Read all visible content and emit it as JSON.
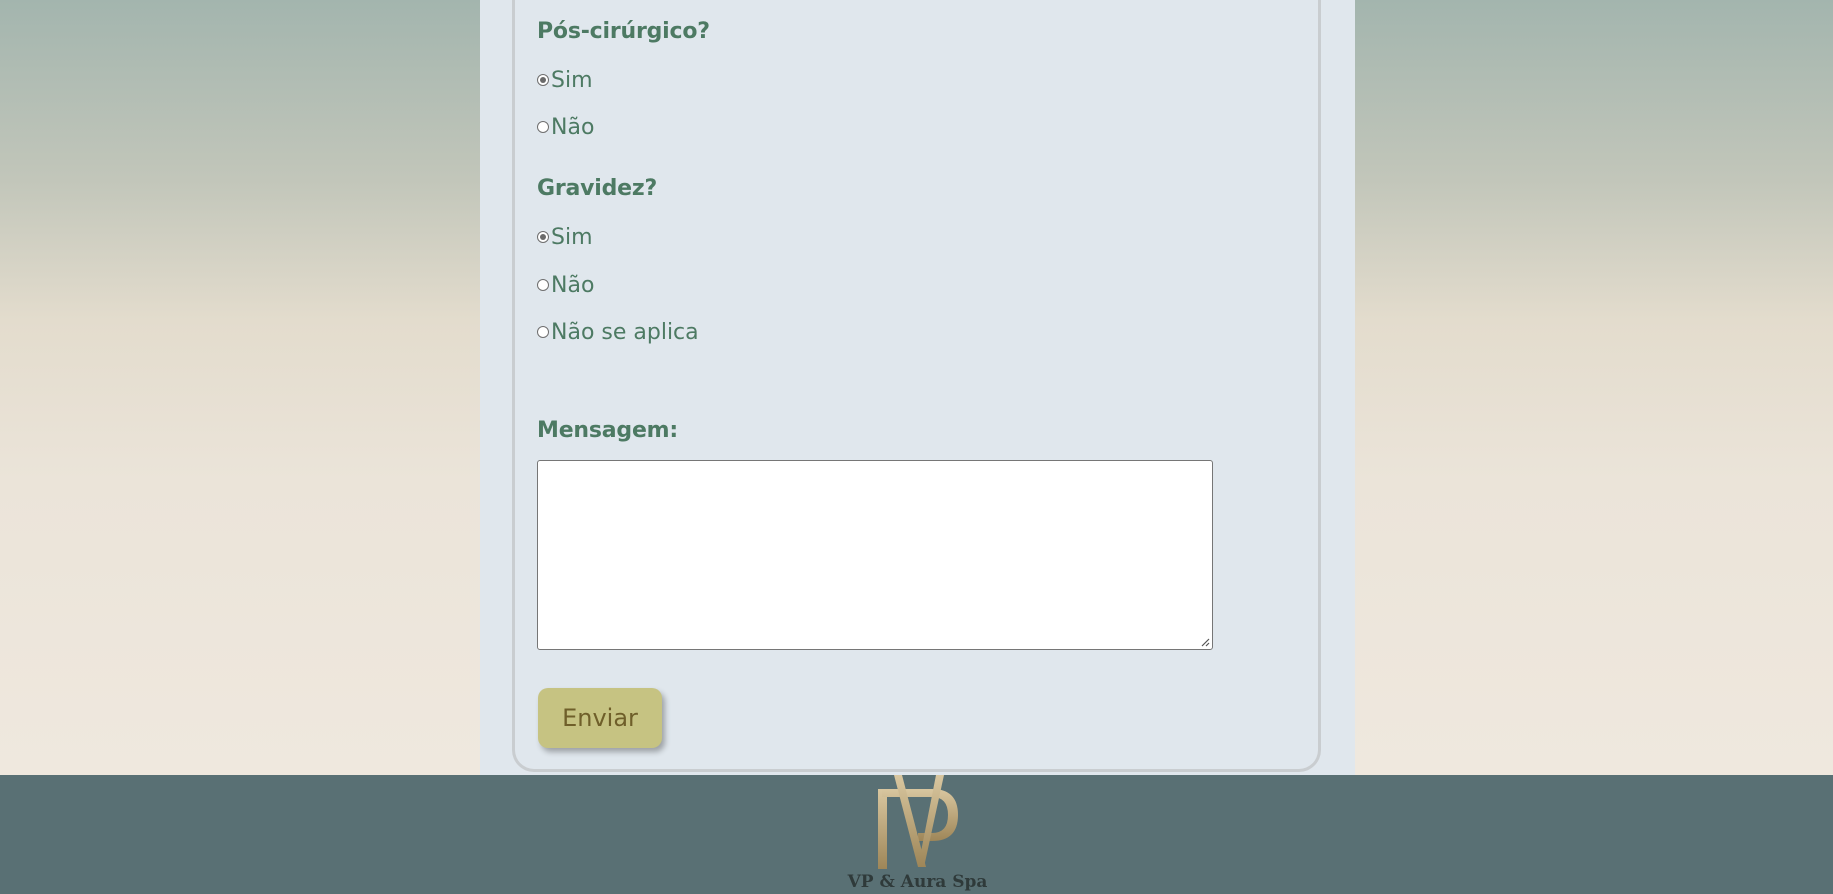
{
  "form": {
    "post_surgery": {
      "label": "Pós-cirúrgico?",
      "options": [
        {
          "label": "Sim",
          "checked": true
        },
        {
          "label": "Não",
          "checked": false
        }
      ]
    },
    "pregnancy": {
      "label": "Gravidez?",
      "options": [
        {
          "label": "Sim",
          "checked": true
        },
        {
          "label": "Não",
          "checked": false
        },
        {
          "label": "Não se aplica",
          "checked": false
        }
      ]
    },
    "message": {
      "label": "Mensagem:",
      "value": ""
    },
    "submit_label": "Enviar"
  },
  "footer": {
    "brand": "VP & Aura Spa",
    "logo_icon": "vp-monogram-logo"
  },
  "colors": {
    "label_green": "#4d7a63",
    "button_bg": "#c6c382",
    "button_text": "#6f5f2a",
    "footer_bg": "#597074",
    "panel_bg": "#e0e7ed"
  }
}
